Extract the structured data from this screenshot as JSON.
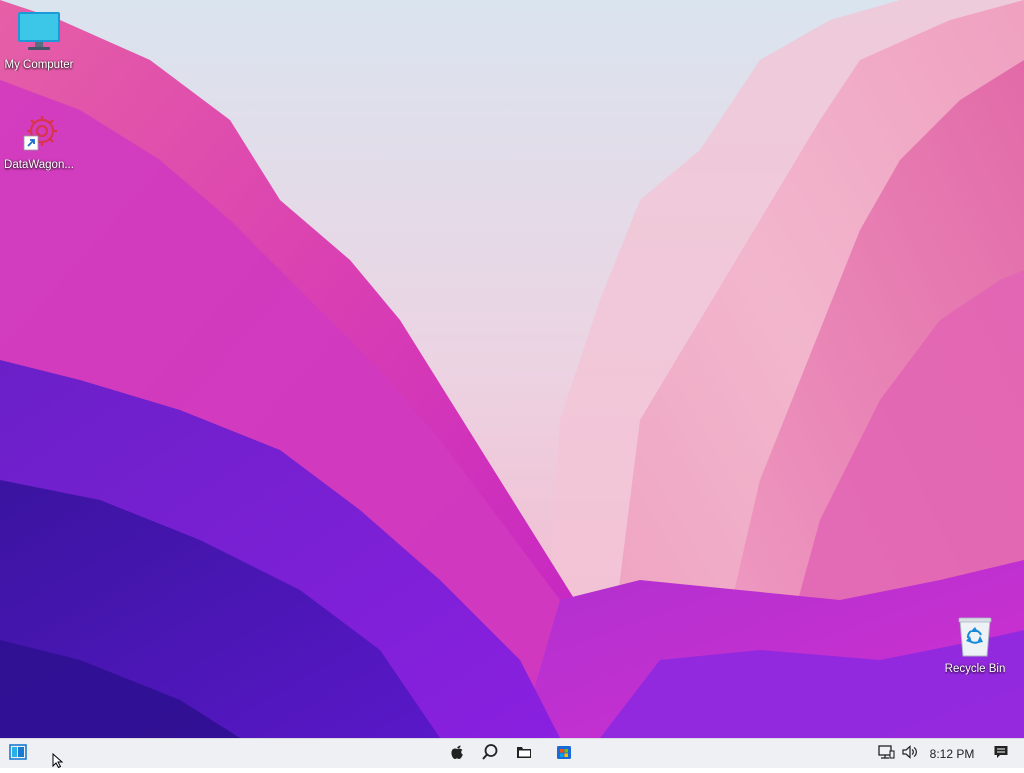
{
  "desktop": {
    "icons": [
      {
        "label": "My Computer",
        "icon": "monitor-icon"
      },
      {
        "label": "DataWagon...",
        "icon": "datawagon-shortcut-icon"
      },
      {
        "label": "Recycle Bin",
        "icon": "recycle-bin-icon"
      }
    ],
    "wallpaper_colors": [
      "#d9e3ee",
      "#f0b8d0",
      "#e05aa8",
      "#c828c0",
      "#7a28d8",
      "#4a1ab0"
    ]
  },
  "taskbar": {
    "start_icon": "start-menu-icon",
    "center_apps": [
      {
        "icon": "apple-icon"
      },
      {
        "icon": "search-icon"
      },
      {
        "icon": "file-explorer-icon"
      },
      {
        "icon": "store-icon"
      }
    ],
    "tray": {
      "network_icon": "network-icon",
      "volume_icon": "volume-icon",
      "clock": "8:12 PM",
      "notification_icon": "notification-icon"
    }
  }
}
